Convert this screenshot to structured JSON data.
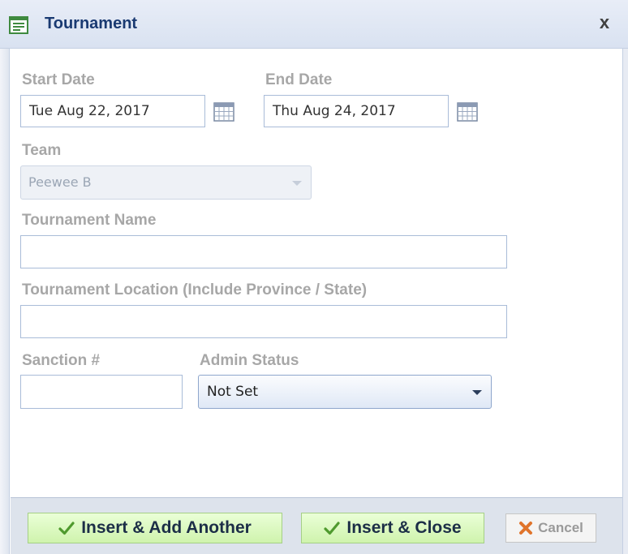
{
  "dialog": {
    "title": "Tournament",
    "close_label": "x"
  },
  "form": {
    "start_date_label": "Start Date",
    "start_date_value": "Tue Aug 22, 2017",
    "end_date_label": "End Date",
    "end_date_value": "Thu Aug 24, 2017",
    "team_label": "Team",
    "team_value": "Peewee B",
    "tournament_name_label": "Tournament Name",
    "tournament_name_value": "",
    "tournament_location_label": "Tournament Location (Include Province / State)",
    "tournament_location_value": "",
    "sanction_label": "Sanction #",
    "sanction_value": "",
    "admin_status_label": "Admin Status",
    "admin_status_value": "Not Set"
  },
  "footer": {
    "insert_add_another_label": "Insert & Add Another",
    "insert_close_label": "Insert & Close",
    "cancel_label": "Cancel"
  },
  "icons": {
    "title": "form-icon",
    "calendar": "calendar-icon",
    "check": "check-icon",
    "cancel": "x-icon"
  },
  "colors": {
    "label": "#a7a7a7",
    "title": "#1a3a72",
    "primary_button_bg": "#cff3ad",
    "input_border": "#a9bcd8"
  }
}
